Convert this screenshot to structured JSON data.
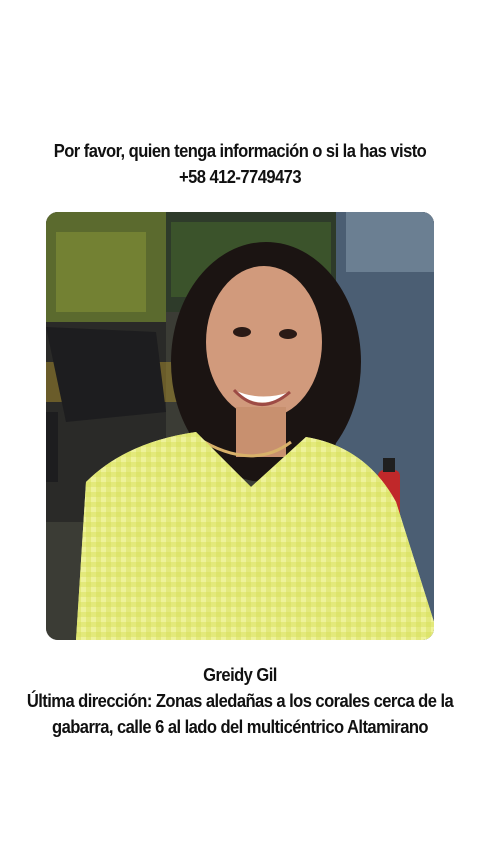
{
  "header": {
    "line1": "Por favor, quien tenga información o si la has visto",
    "line2": "+58 412-7749473"
  },
  "photo": {
    "subject": "smiling woman in yellow gingham shirt"
  },
  "footer": {
    "name": "Greidy Gil",
    "line2": "Última dirección: Zonas aledañas a los corales cerca de la",
    "line3": "gabarra, calle 6 al lado del multicéntrico Altamirano"
  }
}
